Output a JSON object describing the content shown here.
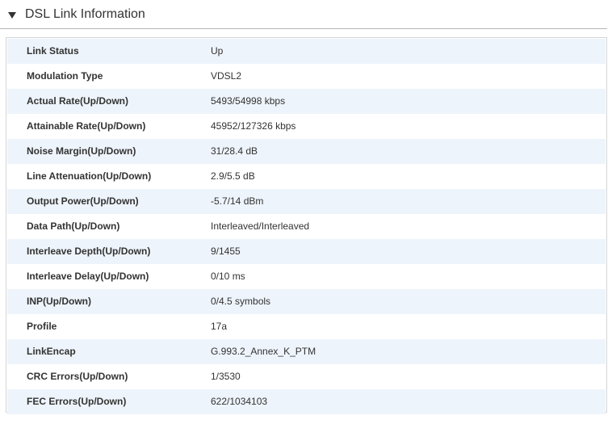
{
  "section": {
    "title": "DSL Link Information",
    "toggle_icon": "triangle-down-icon"
  },
  "colors": {
    "row_stripe": "#eef4fb",
    "border": "#d5d5d5",
    "text": "#333333"
  },
  "rows": [
    {
      "label": "Link Status",
      "value": "Up"
    },
    {
      "label": "Modulation Type",
      "value": "VDSL2"
    },
    {
      "label": "Actual Rate(Up/Down)",
      "value": "5493/54998 kbps"
    },
    {
      "label": "Attainable Rate(Up/Down)",
      "value": "45952/127326 kbps"
    },
    {
      "label": "Noise Margin(Up/Down)",
      "value": "31/28.4 dB"
    },
    {
      "label": "Line Attenuation(Up/Down)",
      "value": "2.9/5.5 dB"
    },
    {
      "label": "Output Power(Up/Down)",
      "value": "-5.7/14 dBm"
    },
    {
      "label": "Data Path(Up/Down)",
      "value": "Interleaved/Interleaved"
    },
    {
      "label": "Interleave Depth(Up/Down)",
      "value": "9/1455"
    },
    {
      "label": "Interleave Delay(Up/Down)",
      "value": "0/10 ms"
    },
    {
      "label": "INP(Up/Down)",
      "value": "0/4.5 symbols"
    },
    {
      "label": "Profile",
      "value": "17a"
    },
    {
      "label": "LinkEncap",
      "value": "G.993.2_Annex_K_PTM"
    },
    {
      "label": "CRC Errors(Up/Down)",
      "value": "1/3530"
    },
    {
      "label": "FEC Errors(Up/Down)",
      "value": "622/1034103"
    }
  ]
}
